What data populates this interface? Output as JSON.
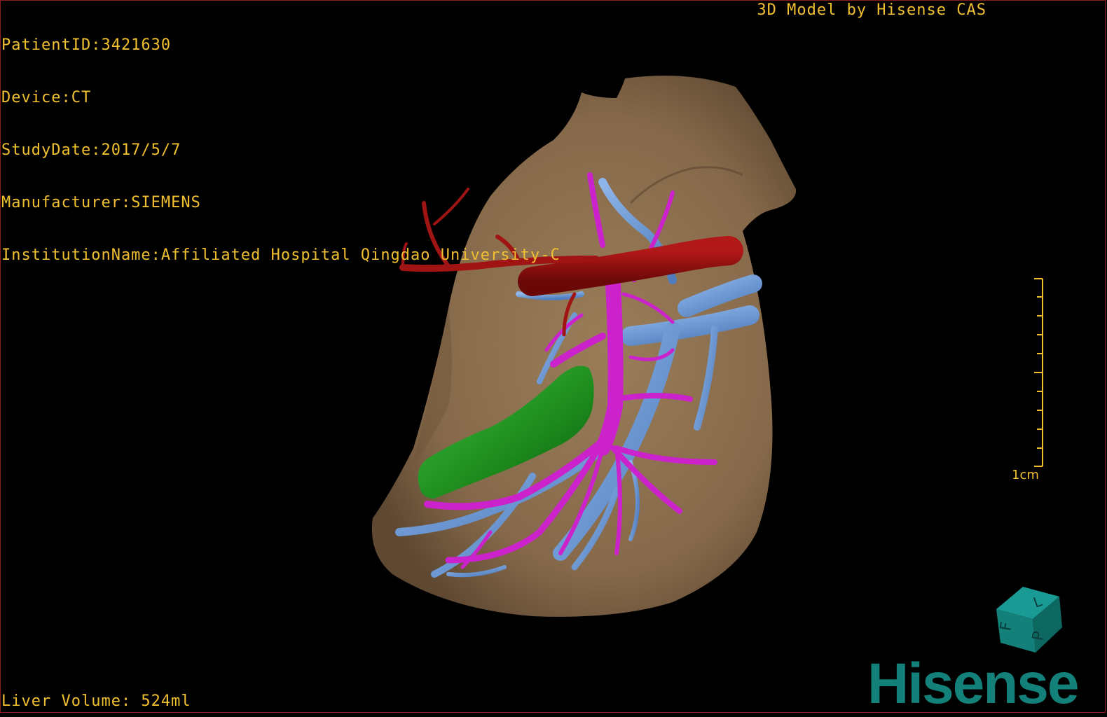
{
  "header": {
    "patient_id": "PatientID:3421630",
    "device": "Device:CT",
    "study_date": "StudyDate:2017/5/7",
    "manufacturer": "Manufacturer:SIEMENS",
    "institution": "InstitutionName:Affiliated Hospital Qingdao University-C"
  },
  "watermark": {
    "title": "3D Model by Hisense CAS",
    "logo": "Hisense"
  },
  "scale_bar": {
    "label": "1cm"
  },
  "orientation_cube": {
    "labels": [
      "F",
      "L",
      "P"
    ]
  },
  "footer": {
    "liver_volume": "Liver Volume: 524ml"
  },
  "colors": {
    "liver": "#8c7150",
    "artery": "#8e0c0c",
    "portal_vein": "#cc22cc",
    "hepatic_vein": "#6a9ad8",
    "tumor": "#1e8a1e",
    "overlay_text": "#f0c030",
    "brand": "#13807a"
  }
}
